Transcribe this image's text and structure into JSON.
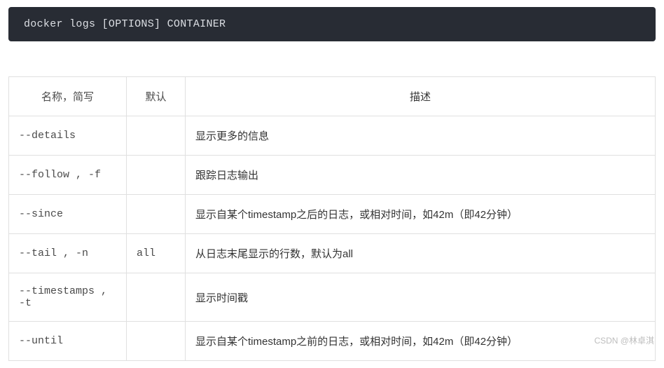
{
  "code": "docker logs [OPTIONS] CONTAINER",
  "headers": {
    "name": "名称，简写",
    "def": "默认",
    "desc": "描述"
  },
  "rows": [
    {
      "name": "--details",
      "def": "",
      "desc": "显示更多的信息"
    },
    {
      "name": "--follow , -f",
      "def": "",
      "desc": "跟踪日志输出"
    },
    {
      "name": "--since",
      "def": "",
      "desc": "显示自某个timestamp之后的日志，或相对时间，如42m（即42分钟）"
    },
    {
      "name": "--tail , -n",
      "def": "all",
      "desc": "从日志末尾显示的行数，默认为all"
    },
    {
      "name": "--timestamps , -t",
      "def": "",
      "desc": "显示时间戳"
    },
    {
      "name": "--until",
      "def": "",
      "desc": "显示自某个timestamp之前的日志，或相对时间，如42m（即42分钟）"
    }
  ],
  "watermark": "CSDN @林卓淇"
}
